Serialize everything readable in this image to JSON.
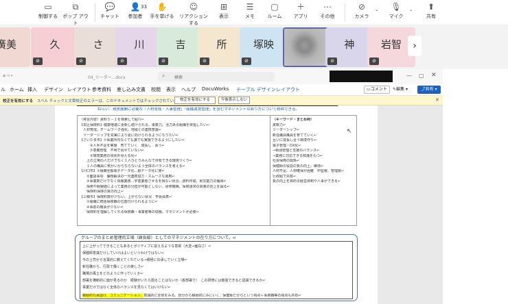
{
  "toolbar": {
    "items": [
      {
        "label": "制御する",
        "icon": "screen-share-icon"
      },
      {
        "label": "ポップ アウト",
        "icon": "popout-icon"
      },
      {
        "label": "チャット",
        "icon": "chat-icon"
      },
      {
        "label": "参加者",
        "icon": "people-icon",
        "count": "33"
      },
      {
        "label": "手を挙げる",
        "icon": "raise-hand-icon"
      },
      {
        "label": "リアクションする",
        "icon": "reaction-icon"
      },
      {
        "label": "表示",
        "icon": "view-icon"
      },
      {
        "label": "メモ",
        "icon": "notes-icon"
      },
      {
        "label": "ルーム",
        "icon": "rooms-icon"
      },
      {
        "label": "アプリ",
        "icon": "apps-icon"
      },
      {
        "label": "その他",
        "icon": "more-icon"
      },
      {
        "label": "カメラ",
        "icon": "camera-off-icon"
      },
      {
        "label": "マイク",
        "icon": "mic-off-icon"
      },
      {
        "label": "共有",
        "icon": "share-icon"
      }
    ]
  },
  "participants": [
    {
      "name": "廣美",
      "color": "#f2d8d2"
    },
    {
      "name": "久",
      "color": "#f5cfd4"
    },
    {
      "name": "さ",
      "color": "#eaded8"
    },
    {
      "name": "川",
      "color": "#e6d6ea"
    },
    {
      "name": "吉",
      "color": "#d8ead9"
    },
    {
      "name": "所",
      "color": "#f5e6cf"
    },
    {
      "name": "塚映",
      "color": "#cfe4f2"
    },
    {
      "name": "",
      "color": "#aaaaaa"
    },
    {
      "name": "神",
      "color": "#d9d5ea"
    },
    {
      "name": "岩智",
      "color": "#f4d8dc"
    }
  ],
  "word": {
    "filename": "04_リーダー...docx",
    "search_placeholder": "検索",
    "menu": [
      "ル",
      "ホーム",
      "挿入",
      "デザイン",
      "レイアウト",
      "参考資料",
      "差し込み文書",
      "校閲",
      "表示",
      "ヘルプ",
      "DocuWorks",
      "テーブル デザイン",
      "レイアウト"
    ],
    "comment_btn": "コメント",
    "edit_btn": "編集",
    "share_btn": "共有",
    "infobar": {
      "title": "校正を有効にする",
      "message": "スペル チェックと文章校正のエラーは、このドキュメントではチェックされていません。",
      "enable_btn": "校正を有効にする",
      "ignore_btn": "今後表示しない"
    }
  },
  "document": {
    "heading": "ねらい：現実展開に必要な「人材育成・人事管理」「組織運営管理」を含むマネジメントのあり方について説明できる。",
    "left_lines": [
      "（発言内容）資料５－１を検索して紹介↵",
      "【本区保険料】健康増進に更新し続けられる。柔軟力。活力ある組織を目指したい↵",
      "　人材育成。チームワーク強化。地域との連携意識↵",
      "　リーダーシップを充実により更に向けられるようになりたい↵",
      "【さいたま市】①事業所内なくても誰でも実施できるようにしたい↵",
      "　　　④人手不足を実施　育てていく　成長し　会う↵",
      "　　　②意義管理　不明で出せていない↵",
      "　　　③環境業務の現状外見える化↵",
      "　　上の立場の人だけでなく１人ひとりみんなで共有できる環境づくり↵",
      "　　１人の職員に気がいからならないよう全体のバランスを考える↵",
      "【川口市】①組織全般電子データ化…紙データ化に使↵",
      "　　②面談事項　課題解決の一元連携協力・スムーズな運用↵",
      "　　③事業数だけでなく情報業務…宇宙業者させるを得ない状況…資料作成。就労能力の獲得↵",
      "　　採用や経験値によって業務の分担が可能としない。研修機構。保険請求の質量の向上を図る↵",
      "　　保険料保険の質の向上↵",
      "【三郷市】保険料数が少ない。上がらない状況　学会員表↵",
      "　　①組織に統括保険職の位置付けられるように↵",
      "　　④事前の機会が少ない↵",
      "　　保険料を理解してくれる保険職・事業者等の協働。マネジメントが必要↵"
    ],
    "right_title": "（キーワード・まとめ枠）",
    "right_lines": [
      "柔軟力↵",
      "リーダーシップ↵",
      "新任職員職員を育てていく↵",
      "互いに成長し合う環境作り↵",
      "電子管理・DX化↵",
      "→街頭管理と支援のバランス↵",
      "→業務に対応できる知識をもつ↵",
      "社会保障の関係↵",
      "保健師の役割の質の向上。維持↵",
      "人材不足、人材確保が困難　中堅層、管理層↵",
      "行政組で共有↵",
      "質の向上を目的る経営体制や人事ができる↵"
    ],
    "group_title": "グループのまとめ管理的立場（課長級）としてのマネジメントの在り方について。↵",
    "group_lines": [
      "上に上がってできることもあるとポジティブに捉えるような意欲（大変⇒面白さ）↵",
      "保健師意識だけしていけばよいというわけではない↵",
      "今の上司から言葉的に教えてくれている→積極に伝承していく立場↵",
      "新任職から、行政で働くことの楽しさ↵",
      "職場の風土をどのように作っていくか↵",
      "部署を横断的に面が見るのか　経験がいたら困ることはないか（各部署で）　この研修には勉強できると認識できるか↵",
      "事業だけではなく全体のバランスを見なくてはいけない↵"
    ],
    "last_line_highlight": "積極的な承認け、コミュニケーション、",
    "last_line_rest": "意識的に全体をみる。自分から積極的にみにいく、保健師だからという視点＋事務職等の視点も共有↵"
  }
}
